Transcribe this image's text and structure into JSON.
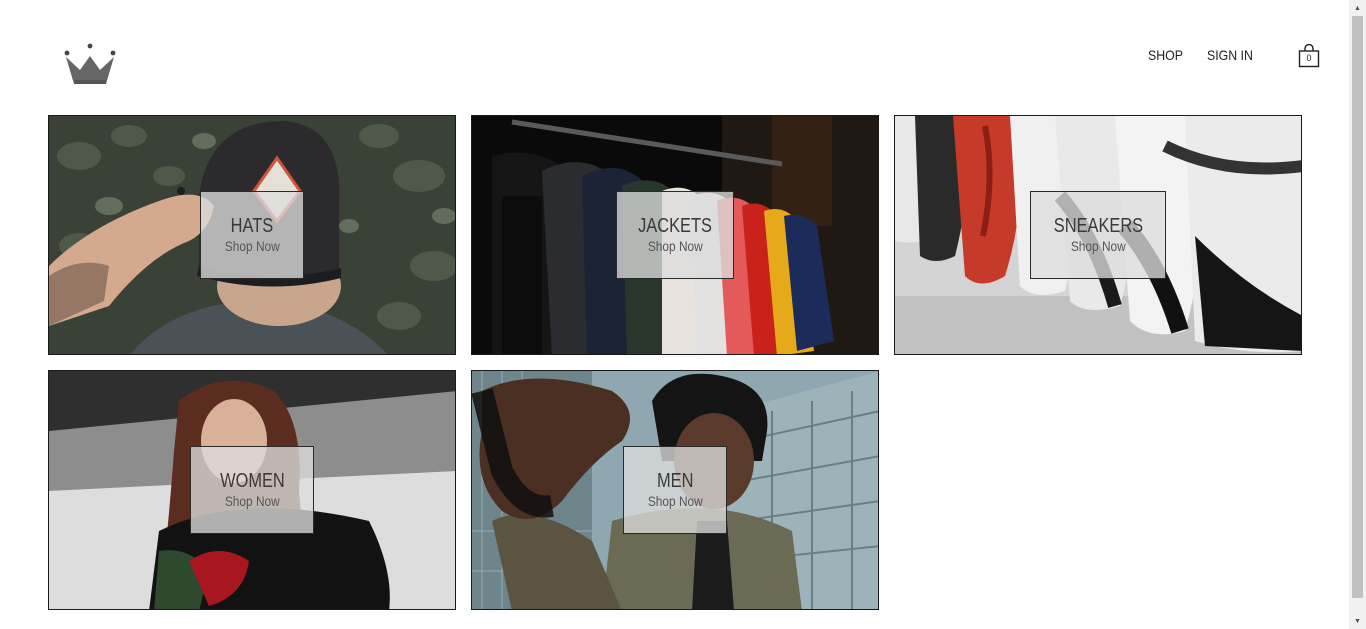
{
  "header": {
    "nav": {
      "shop_label": "SHOP",
      "signin_label": "SIGN IN"
    },
    "cart": {
      "count": "0",
      "icon": "shopping-bag-icon"
    },
    "logo": {
      "icon": "crown-logo"
    }
  },
  "directory": {
    "items": [
      {
        "title": "HATS",
        "subtitle": "Shop Now"
      },
      {
        "title": "JACKETS",
        "subtitle": "Shop Now"
      },
      {
        "title": "SNEAKERS",
        "subtitle": "Shop Now"
      },
      {
        "title": "WOMEN",
        "subtitle": "Shop Now"
      },
      {
        "title": "MEN",
        "subtitle": "Shop Now"
      }
    ]
  },
  "colors": {
    "border": "#1a1a1a",
    "label_bg": "#dcdcdc",
    "text": "#222222"
  }
}
